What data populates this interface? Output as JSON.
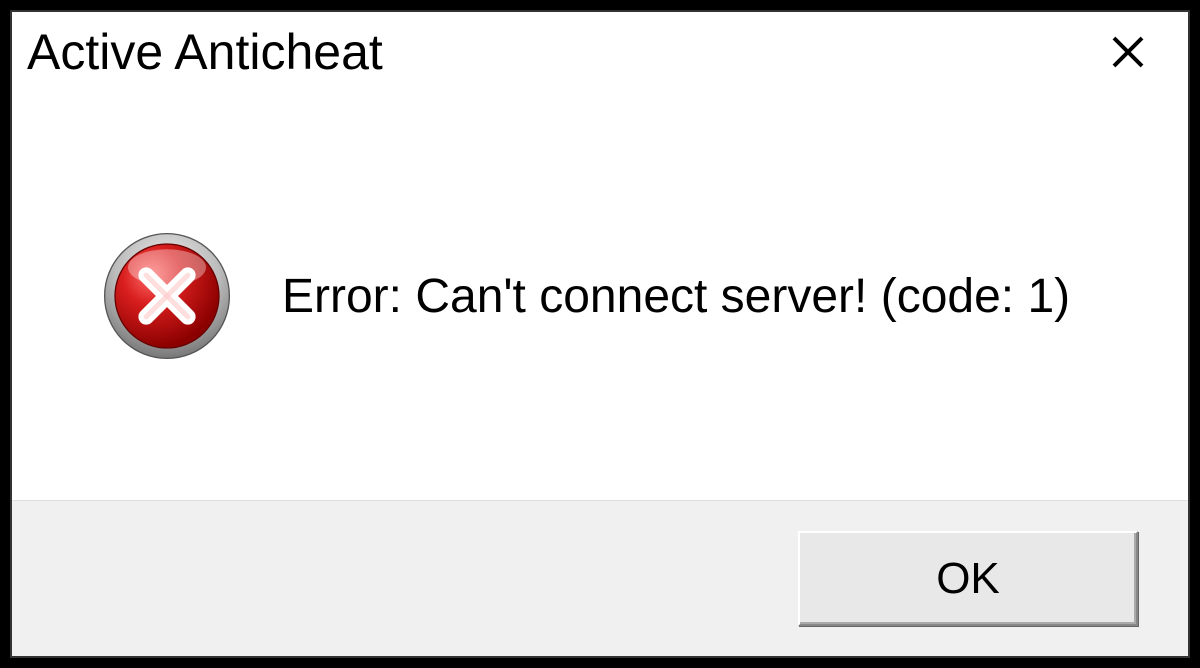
{
  "dialog": {
    "title": "Active Anticheat",
    "message": "Error: Can't connect server! (code: 1)",
    "buttons": {
      "ok": "OK"
    },
    "icon": "error-icon"
  }
}
